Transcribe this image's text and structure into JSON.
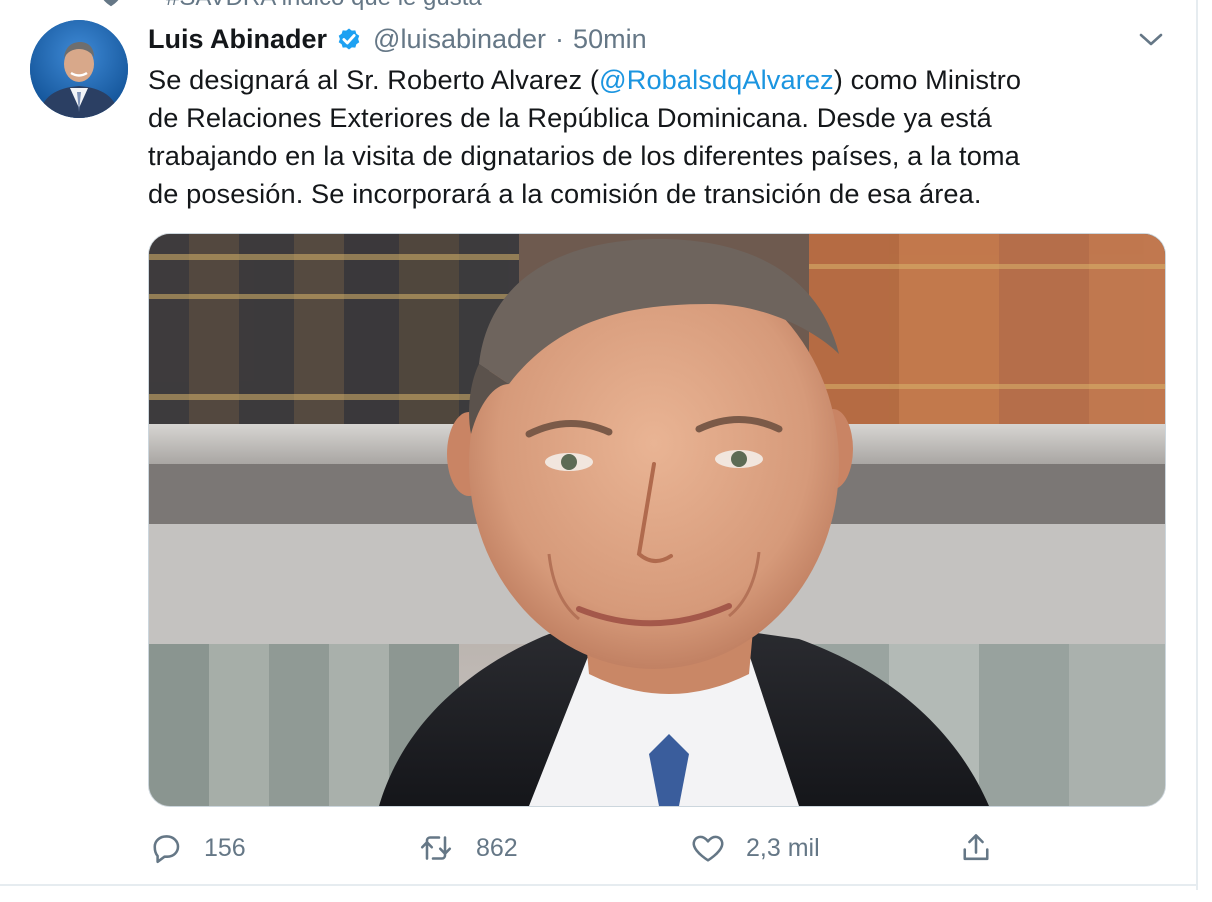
{
  "social_context": {
    "text": "#SAVDRA indicó que le gusta",
    "icon": "heart-icon"
  },
  "tweet": {
    "author": {
      "name": "Luis Abinader",
      "verified": true,
      "handle": "@luisabinader",
      "separator": "·",
      "time": "50min"
    },
    "text_lines": [
      {
        "before": "Se designará al Sr. Roberto Alvarez (",
        "mention": "@RobalsdqAlvarez",
        "after": ") como Ministro"
      },
      {
        "text": "de Relaciones Exteriores de la República Dominicana. Desde ya está"
      },
      {
        "text": "trabajando en la visita de dignatarios de los diferentes países, a la toma"
      },
      {
        "text": "de posesión. Se incorporará a la comisión de transición de esa área."
      }
    ],
    "media": {
      "kind": "photo"
    },
    "actions": {
      "reply": {
        "icon": "reply-icon",
        "count": "156"
      },
      "retweet": {
        "icon": "retweet-icon",
        "count": "862"
      },
      "like": {
        "icon": "heart-icon",
        "count": "2,3 mil"
      },
      "share": {
        "icon": "share-icon"
      }
    }
  },
  "colors": {
    "text_primary": "#14171a",
    "text_secondary": "#657786",
    "link": "#1b95e0",
    "verified_badge": "#1da1f2",
    "border": "#e6ecf0"
  }
}
